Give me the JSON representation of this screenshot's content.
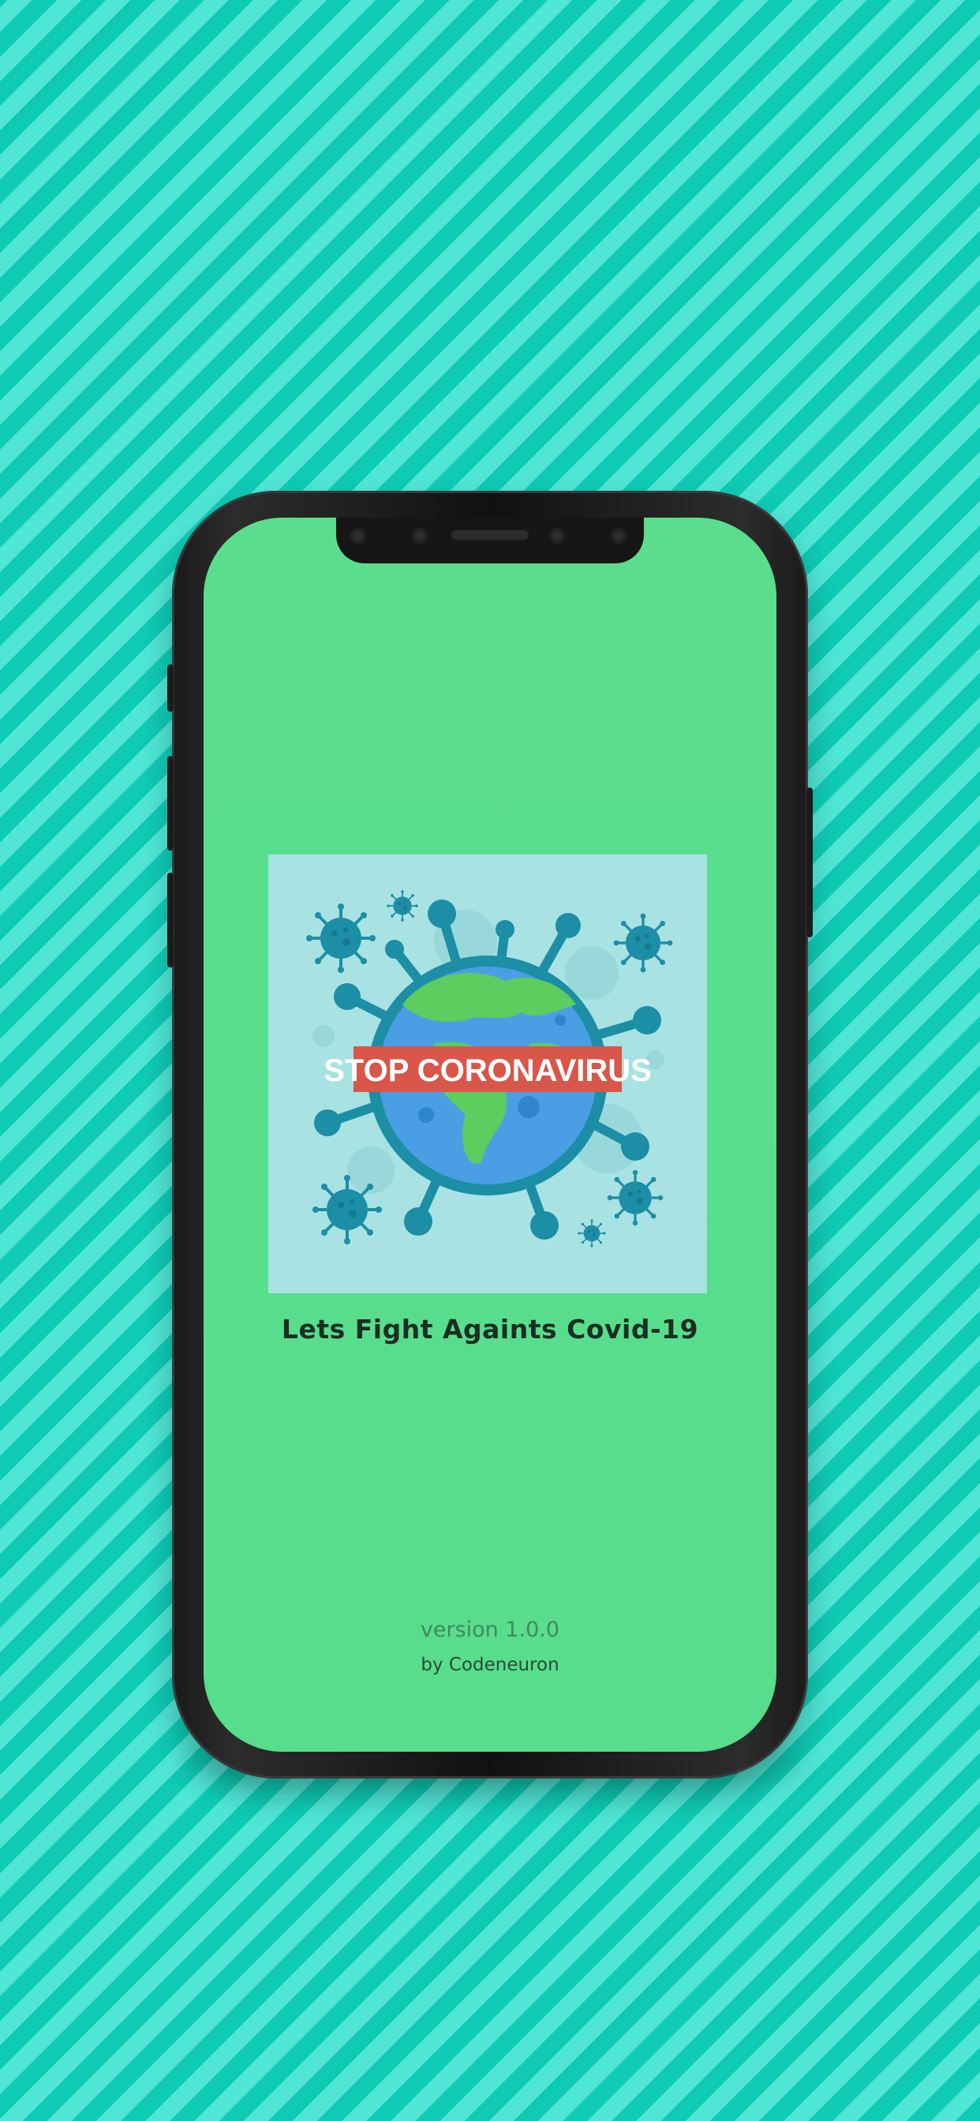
{
  "splash": {
    "banner_text": "STOP CORONAVIRUS",
    "title": "Lets Fight Againts Covid-19",
    "version": "version 1.0.0",
    "credit": "by Codeneuron"
  },
  "colors": {
    "screen_bg": "#58dd8c",
    "poster_bg": "#a8e2e2",
    "banner_red": "#d9564a",
    "virus_teal": "#1c8ea5",
    "globe_blue": "#4a9fe4",
    "land_green": "#5ccd5e"
  },
  "icons": [
    "coronavirus-icon",
    "globe-icon"
  ]
}
